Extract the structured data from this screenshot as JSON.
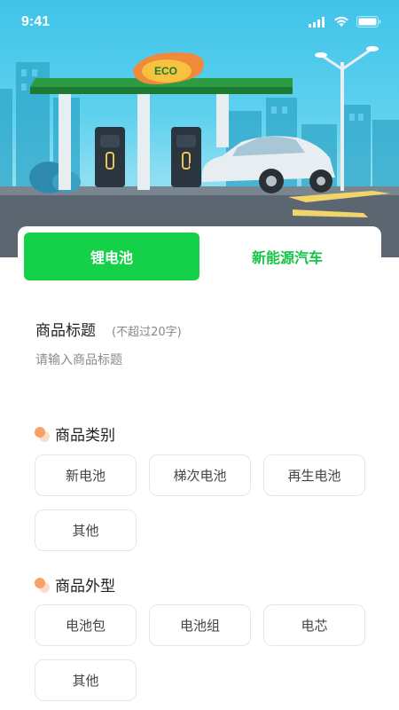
{
  "status_bar": {
    "time": "9:41",
    "icons": [
      "cellular-signal-icon",
      "wifi-icon",
      "battery-icon"
    ]
  },
  "hero": {
    "illustration": "ev-charging-station",
    "sign_text": "ECO"
  },
  "tabs": [
    {
      "label": "锂电池",
      "active": true
    },
    {
      "label": "新能源汽车",
      "active": false
    }
  ],
  "form": {
    "title_label": "商品标题",
    "title_hint": "(不超过20字)",
    "title_placeholder": "请输入商品标题"
  },
  "category": {
    "label": "商品类别",
    "options": [
      "新电池",
      "梯次电池",
      "再生电池",
      "其他"
    ]
  },
  "shape": {
    "label": "商品外型",
    "options": [
      "电池包",
      "电池组",
      "电芯",
      "其他"
    ]
  },
  "colors": {
    "accent": "#15d14a",
    "dot": "#f7a067"
  }
}
